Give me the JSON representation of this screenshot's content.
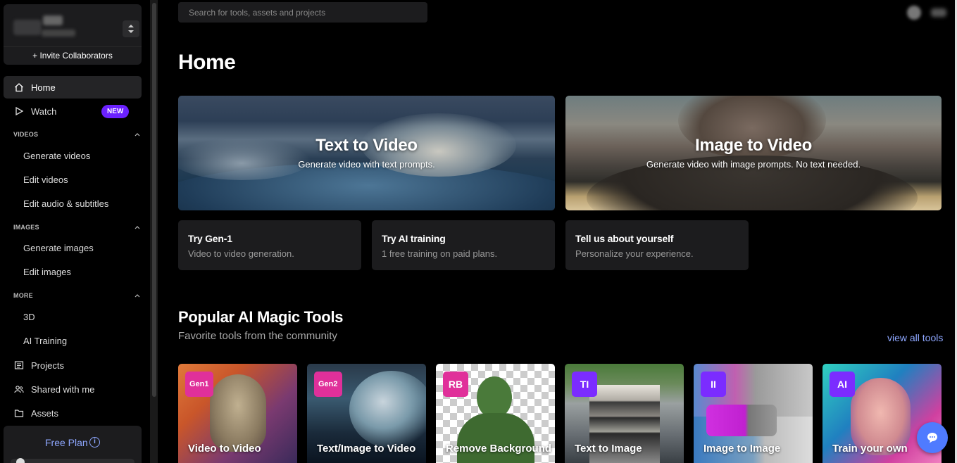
{
  "sidebar": {
    "invite_label": "+ Invite Collaborators",
    "nav": {
      "home": "Home",
      "watch": "Watch",
      "watch_badge": "NEW",
      "projects": "Projects",
      "shared": "Shared with me",
      "assets": "Assets"
    },
    "sections": {
      "videos": {
        "title": "VIDEOS",
        "items": [
          "Generate videos",
          "Edit videos",
          "Edit audio & subtitles"
        ]
      },
      "images": {
        "title": "IMAGES",
        "items": [
          "Generate images",
          "Edit images"
        ]
      },
      "more": {
        "title": "MORE",
        "items": [
          "3D",
          "AI Training"
        ]
      }
    },
    "plan": {
      "label": "Free Plan",
      "info_icon": "i"
    }
  },
  "header": {
    "search_placeholder": "Search for tools, assets and projects"
  },
  "main": {
    "title": "Home",
    "heroes": [
      {
        "title": "Text to Video",
        "subtitle": "Generate video with text prompts."
      },
      {
        "title": "Image to Video",
        "subtitle": "Generate video with image prompts. No text needed."
      }
    ],
    "cards": [
      {
        "title": "Try Gen-1",
        "subtitle": "Video to video generation."
      },
      {
        "title": "Try AI training",
        "subtitle": "1 free training on paid plans."
      },
      {
        "title": "Tell us about yourself",
        "subtitle": "Personalize your experience."
      }
    ],
    "tools_section": {
      "title": "Popular AI Magic Tools",
      "subtitle": "Favorite tools from the community",
      "view_all": "view all tools",
      "tools": [
        {
          "badge": "Gen1",
          "label": "Video to Video",
          "badge_color": "#e0309a"
        },
        {
          "badge": "Gen2",
          "label": "Text/Image to Video",
          "badge_color": "#e0309a"
        },
        {
          "badge": "RB",
          "label": "Remove Background",
          "badge_color": "#e0309a"
        },
        {
          "badge": "TI",
          "label": "Text to Image",
          "badge_color": "#7b2cff"
        },
        {
          "badge": "II",
          "label": "Image to Image",
          "badge_color": "#7b2cff"
        },
        {
          "badge": "AI",
          "label": "Train your own",
          "badge_color": "#7b2cff"
        }
      ]
    }
  },
  "colors": {
    "accent_link": "#8ea7ff",
    "new_badge": "#6b21ff",
    "chat_button": "#4f7bff"
  }
}
